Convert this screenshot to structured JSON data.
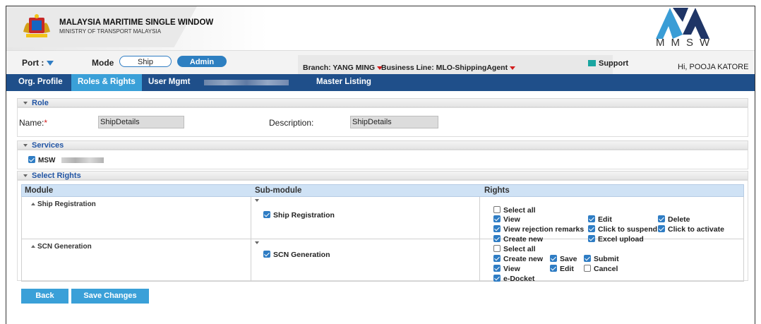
{
  "header": {
    "title": "MALAYSIA MARITIME SINGLE WINDOW",
    "subtitle": "MINISTRY OF TRANSPORT MALAYSIA",
    "logo_text": "MMSW"
  },
  "topbar": {
    "port_label": "Port :",
    "mode_label": "Mode",
    "mode_options": [
      "Ship",
      "Admin"
    ],
    "branch": "Branch: YANG MING",
    "business_line": "Business Line: MLO-ShippingAgent",
    "support": "Support",
    "user": "Hi, POOJA KATORE"
  },
  "nav": {
    "tabs": [
      "Org. Profile",
      "Roles & Rights",
      "User Mgmt",
      "Master Listing"
    ],
    "active": "Roles & Rights"
  },
  "role": {
    "section_title": "Role",
    "name_label": "Name:",
    "name_required": "*",
    "name_value": "ShipDetails",
    "description_label": "Description:",
    "description_value": "ShipDetails"
  },
  "services": {
    "section_title": "Services",
    "items": [
      {
        "label": "MSW",
        "checked": true
      }
    ]
  },
  "rights": {
    "section_title": "Select Rights",
    "columns": [
      "Module",
      "Sub-module",
      "Rights"
    ],
    "rows": [
      {
        "module": "Ship Registration",
        "submodule": "Ship Registration",
        "submodule_checked": true,
        "rights": [
          {
            "label": "Select all",
            "checked": false
          },
          {
            "label": "View",
            "checked": true
          },
          {
            "label": "Edit",
            "checked": true
          },
          {
            "label": "Delete",
            "checked": true
          },
          {
            "label": "View rejection remarks",
            "checked": true
          },
          {
            "label": "Click to suspend",
            "checked": true
          },
          {
            "label": "Click to activate",
            "checked": true
          },
          {
            "label": "Create new",
            "checked": true
          },
          {
            "label": "Excel upload",
            "checked": true
          }
        ]
      },
      {
        "module": "SCN Generation",
        "submodule": "SCN Generation",
        "submodule_checked": true,
        "rights": [
          {
            "label": "Select all",
            "checked": false
          },
          {
            "label": "Create new",
            "checked": true
          },
          {
            "label": "Save",
            "checked": true
          },
          {
            "label": "Submit",
            "checked": true
          },
          {
            "label": "View",
            "checked": true
          },
          {
            "label": "Edit",
            "checked": true
          },
          {
            "label": "Cancel",
            "checked": false
          },
          {
            "label": "e-Docket",
            "checked": true
          }
        ]
      }
    ]
  },
  "actions": {
    "back": "Back",
    "save": "Save Changes"
  },
  "colors": {
    "nav_bg": "#1f4f8a",
    "accent": "#3aa0d8",
    "checkbox": "#2f7dc4",
    "required": "#d21d1d"
  }
}
